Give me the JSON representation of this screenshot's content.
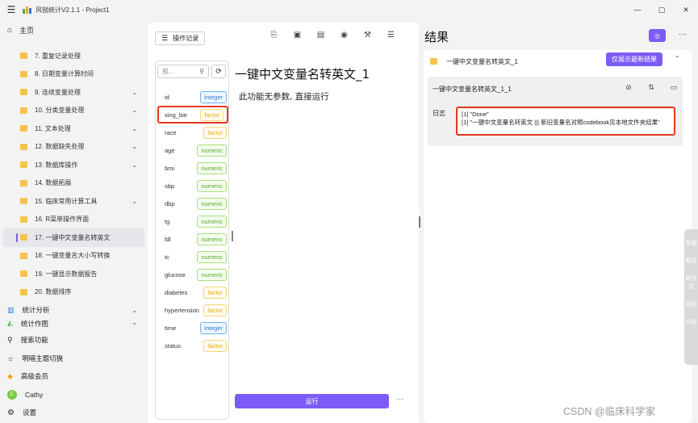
{
  "window": {
    "title": "风锐统计V2.1.1 - Project1",
    "controls": [
      "—",
      "▢",
      "✕"
    ]
  },
  "sidebar": {
    "home_label": "主页",
    "items": [
      {
        "label": "7. 重复记录处理",
        "has_chevron": false
      },
      {
        "label": "8. 日期变量计算时间",
        "has_chevron": false
      },
      {
        "label": "9. 连续变量处理",
        "has_chevron": true
      },
      {
        "label": "10. 分类变量处理",
        "has_chevron": true
      },
      {
        "label": "11. 文本处理",
        "has_chevron": true
      },
      {
        "label": "12. 数据缺失处理",
        "has_chevron": true
      },
      {
        "label": "13. 数据库操作",
        "has_chevron": true
      },
      {
        "label": "14. 数据拓展",
        "has_chevron": false
      },
      {
        "label": "15. 临床常用计算工具",
        "has_chevron": true
      },
      {
        "label": "16. R菜单操作界面",
        "has_chevron": false
      },
      {
        "label": "17. 一键中文变量名转英文",
        "has_chevron": false,
        "active": true
      },
      {
        "label": "18. 一键变量名大小写转换",
        "has_chevron": false
      },
      {
        "label": "19. 一键显示数据报告",
        "has_chevron": false
      },
      {
        "label": "20. 数据排序",
        "has_chevron": false
      }
    ],
    "groups": [
      {
        "label": "统计分析"
      },
      {
        "label": "统计作图"
      }
    ],
    "bottom": {
      "search": "搜索功能",
      "theme": "明暗主题切换",
      "premium": "高级会员",
      "user_initial": "C",
      "user_name": "Cathy",
      "settings": "设置"
    }
  },
  "toolbar": {
    "ops_label": "操作记录"
  },
  "variables": {
    "search_placeholder": "报...",
    "list": [
      {
        "name": "id",
        "type": "integer"
      },
      {
        "name": "xing_bie",
        "type": "factor",
        "selected": true
      },
      {
        "name": "race",
        "type": "factor"
      },
      {
        "name": "age",
        "type": "numeric"
      },
      {
        "name": "bmi",
        "type": "numeric"
      },
      {
        "name": "sbp",
        "type": "numeric"
      },
      {
        "name": "dbp",
        "type": "numeric"
      },
      {
        "name": "tg",
        "type": "numeric"
      },
      {
        "name": "ldl",
        "type": "numeric"
      },
      {
        "name": "tc",
        "type": "numeric"
      },
      {
        "name": "glucose",
        "type": "numeric"
      },
      {
        "name": "diabetes",
        "type": "factor"
      },
      {
        "name": "hypertension",
        "type": "factor"
      },
      {
        "name": "time",
        "type": "integer"
      },
      {
        "name": "status",
        "type": "factor"
      }
    ]
  },
  "function": {
    "title": "一键中文变量名转英文_1",
    "description": "此功能无参数, 直接运行",
    "run_label": "运行",
    "more": "···"
  },
  "results": {
    "title": "结果",
    "more": "···",
    "card_title": "一键中文变量名转英文_1",
    "latest_button": "仅展示最新结果",
    "inner_title": "一键中文变量名转英文_1_1",
    "log_label": "日志",
    "log_lines": [
      "[1] \"Done\"",
      "[1] \"一键中文变量名转英文 ||| 新旧变量名对照codebook见本地文件夹结果\""
    ]
  },
  "float_bar": [
    "客服",
    "教程",
    "群交流",
    "视频",
    "文档"
  ],
  "watermark": "CSDN @临床科学家",
  "colors": {
    "accent": "#7c5cf5",
    "highlight": "#e2391b",
    "folder": "#f5c34a"
  }
}
